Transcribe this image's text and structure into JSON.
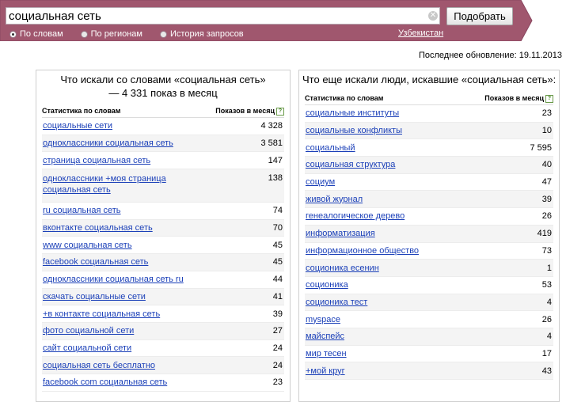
{
  "search": {
    "value": "социальная сеть",
    "submit_label": "Подобрать"
  },
  "modes": [
    {
      "label": "По словам",
      "selected": true
    },
    {
      "label": "По регионам",
      "selected": false
    },
    {
      "label": "История запросов",
      "selected": false
    }
  ],
  "region": "Узбекистан",
  "updated": "Последнее обновление: 19.11.2013",
  "colors": {
    "band": "#a0576e",
    "link": "#1a3fb8"
  },
  "left_panel": {
    "title": "Что искали со словами «социальная сеть» — 4 331 показ в месяц",
    "col_phrase": "Статистика по словам",
    "col_count": "Показов в месяц",
    "rows": [
      {
        "phrase": "социальные сети",
        "count": "4 328"
      },
      {
        "phrase": "одноклассники социальная сеть",
        "count": "3 581"
      },
      {
        "phrase": "страница социальная сеть",
        "count": "147"
      },
      {
        "phrase": "одноклассники +моя страница социальная сеть",
        "count": "138"
      },
      {
        "phrase": "ru социальная сеть",
        "count": "74"
      },
      {
        "phrase": "вконтакте социальная сеть",
        "count": "70"
      },
      {
        "phrase": "www социальная сеть",
        "count": "45"
      },
      {
        "phrase": "facebook социальная сеть",
        "count": "45"
      },
      {
        "phrase": "одноклассники социальная сеть ru",
        "count": "44"
      },
      {
        "phrase": "скачать социальные сети",
        "count": "41"
      },
      {
        "phrase": "+в контакте социальная сеть",
        "count": "39"
      },
      {
        "phrase": "фото социальной сети",
        "count": "27"
      },
      {
        "phrase": "сайт социальной сети",
        "count": "24"
      },
      {
        "phrase": "социальная сеть бесплатно",
        "count": "24"
      },
      {
        "phrase": "facebook com социальная сеть",
        "count": "23"
      }
    ]
  },
  "right_panel": {
    "title": "Что еще искали люди, искавшие «социальная сеть»:",
    "col_phrase": "Статистика по словам",
    "col_count": "Показов в месяц",
    "rows": [
      {
        "phrase": "социальные институты",
        "count": "23"
      },
      {
        "phrase": "социальные конфликты",
        "count": "10"
      },
      {
        "phrase": "социальный",
        "count": "7 595"
      },
      {
        "phrase": "социальная структура",
        "count": "40"
      },
      {
        "phrase": "социум",
        "count": "47"
      },
      {
        "phrase": "живой журнал",
        "count": "39"
      },
      {
        "phrase": "генеалогическое дерево",
        "count": "26"
      },
      {
        "phrase": "информатизация",
        "count": "419"
      },
      {
        "phrase": "информационное общество",
        "count": "73"
      },
      {
        "phrase": "соционика есенин",
        "count": "1"
      },
      {
        "phrase": "соционика",
        "count": "53"
      },
      {
        "phrase": "соционика тест",
        "count": "4"
      },
      {
        "phrase": "myspace",
        "count": "26"
      },
      {
        "phrase": "майспейс",
        "count": "4"
      },
      {
        "phrase": "мир тесен",
        "count": "17"
      },
      {
        "phrase": "+мой круг",
        "count": "43"
      }
    ]
  }
}
